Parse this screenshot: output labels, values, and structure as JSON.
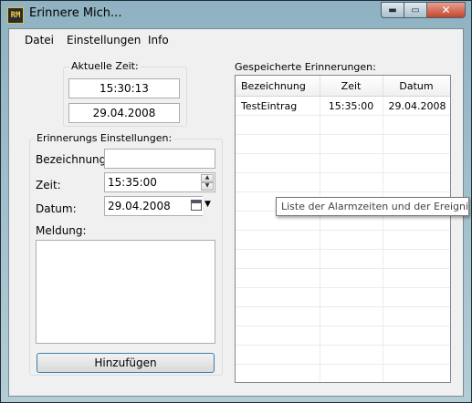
{
  "window": {
    "title": "Erinnere Mich...",
    "icon_text": "RM",
    "min_symbol": "▬",
    "max_symbol": "▭",
    "close_symbol": "✕"
  },
  "menu": [
    {
      "label": "Datei"
    },
    {
      "label": "Einstellungen"
    },
    {
      "label": "Info"
    }
  ],
  "current_time": {
    "group_label": "Aktuelle Zeit:",
    "time": "15:30:13",
    "date": "29.04.2008"
  },
  "settings": {
    "group_label": "Erinnerungs Einstellungen:",
    "name_label": "Bezeichnung:",
    "name_value": "",
    "time_label": "Zeit:",
    "time_value": "15:35:00",
    "date_label": "Datum:",
    "date_value": "29.04.2008",
    "message_label": "Meldung:",
    "message_value": "",
    "add_button": "Hinzufügen"
  },
  "saved": {
    "label": "Gespeicherte Erinnerungen:",
    "columns": [
      "Bezeichnung",
      "Zeit",
      "Datum"
    ],
    "rows": [
      [
        "TestEintrag",
        "15:35:00",
        "29.04.2008"
      ]
    ]
  },
  "tooltip": "Liste der Alarmzeiten und der Ereignisse"
}
